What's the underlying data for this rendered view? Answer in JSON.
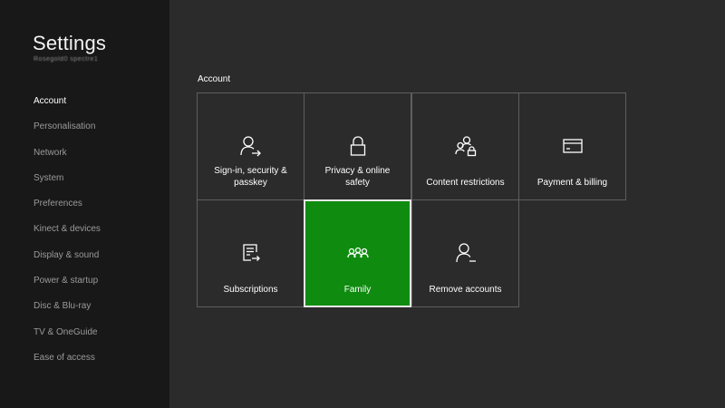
{
  "sidebar": {
    "title": "Settings",
    "subtitle": "Rosegold0  spectre1",
    "items": [
      {
        "label": "Account",
        "active": true
      },
      {
        "label": "Personalisation"
      },
      {
        "label": "Network"
      },
      {
        "label": "System"
      },
      {
        "label": "Preferences"
      },
      {
        "label": "Kinect & devices"
      },
      {
        "label": "Display & sound"
      },
      {
        "label": "Power & startup"
      },
      {
        "label": "Disc & Blu-ray"
      },
      {
        "label": "TV & OneGuide"
      },
      {
        "label": "Ease of access"
      }
    ]
  },
  "main": {
    "section_title": "Account",
    "tiles": [
      {
        "label": "Sign-in, security & passkey",
        "icon": "person-arrow-icon"
      },
      {
        "label": "Privacy & online safety",
        "icon": "lock-icon"
      },
      {
        "label": "Content restrictions",
        "icon": "people-lock-icon"
      },
      {
        "label": "Payment & billing",
        "icon": "credit-card-icon"
      },
      {
        "label": "Subscriptions",
        "icon": "document-arrow-icon"
      },
      {
        "label": "Family",
        "icon": "family-icon",
        "focused": true
      },
      {
        "label": "Remove accounts",
        "icon": "person-minus-icon"
      }
    ]
  },
  "colors": {
    "background": "#2b2b2b",
    "sidebar": "#181818",
    "focus_accent": "#0f8c0f",
    "tile_border": "#5e5e5e"
  }
}
